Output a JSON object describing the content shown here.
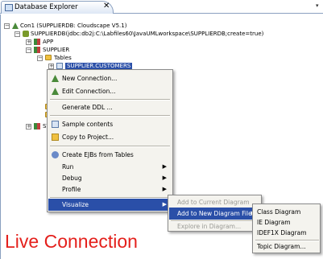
{
  "tab": {
    "title": "Database Explorer",
    "close": "✕",
    "overflow": "▾"
  },
  "tree": {
    "con1": "Con1 (SUPPLIERDB: Cloudscape V5.1)",
    "db": "SUPPLIERDB(jdbc:db2j:C:\\Labfiles60\\JavaUMLworkspace\\SUPPLIERDB;create=true)",
    "app": "APP",
    "supplier": "SUPPLIER",
    "tables": "Tables",
    "table_selected": "SUPPLIER.CUSTOMERS",
    "sys": "SYS"
  },
  "menu": {
    "new_connection": "New Connection...",
    "edit_connection": "Edit Connection...",
    "generate_ddl": "Generate DDL ...",
    "sample_contents": "Sample contents",
    "copy_to_project": "Copy to Project...",
    "create_ejbs": "Create EJBs from Tables",
    "run": "Run",
    "debug": "Debug",
    "profile": "Profile",
    "visualize": "Visualize"
  },
  "submenu_visualize": {
    "add_to_current": "Add to Current Diagram",
    "add_to_new_file": "Add to New Diagram File",
    "explore": "Explore in Diagram..."
  },
  "submenu_new_file": {
    "class_diagram": "Class Diagram",
    "ie_diagram": "IE Diagram",
    "idef1x_diagram": "IDEF1X Diagram",
    "topic_diagram": "Topic Diagram..."
  },
  "overlay_caption": "Live Connection"
}
